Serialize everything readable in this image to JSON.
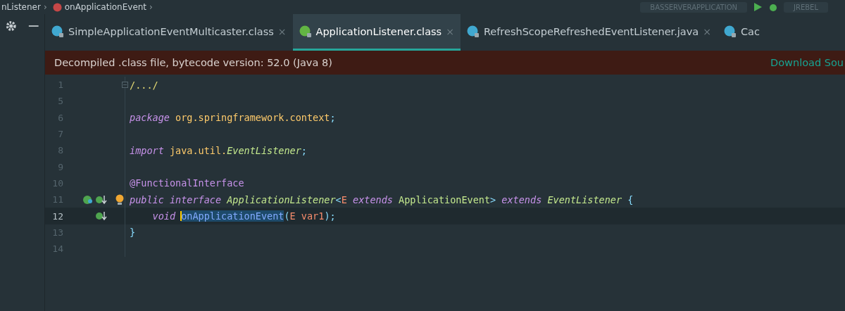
{
  "breadcrumbs": [
    {
      "label": "nListener",
      "kind": "interface",
      "separator": "›"
    },
    {
      "label": "onApplicationEvent",
      "kind": "method",
      "separator": "›"
    }
  ],
  "run_config": {
    "label": "BASSERVERAPPLICATION"
  },
  "plugin_config": {
    "label": "JREBEL"
  },
  "tabs": [
    {
      "label": "SimpleApplicationEventMulticaster.class",
      "kind": "class",
      "selected": false,
      "close": "×"
    },
    {
      "label": "ApplicationListener.class",
      "kind": "interface",
      "selected": true,
      "close": "×"
    },
    {
      "label": "RefreshScopeRefreshedEventListener.java",
      "kind": "class",
      "selected": false,
      "close": "×"
    },
    {
      "label": "Cac",
      "kind": "class",
      "selected": false
    }
  ],
  "banner": {
    "message": "Decompiled .class file, bytecode version: 52.0 (Java 8)",
    "action": "Download Sou"
  },
  "lines": [
    {
      "number": "1",
      "current": false,
      "folded": true,
      "tokens": [
        {
          "text": "/.../",
          "kind": "fold"
        }
      ]
    },
    {
      "number": "5",
      "current": false
    },
    {
      "number": "6",
      "current": false,
      "tokens": [
        {
          "text": "package",
          "kind": "keyword"
        },
        {
          "text": " org.springframework.context",
          "kind": "name"
        },
        {
          "text": ";",
          "kind": "punct"
        }
      ]
    },
    {
      "number": "7",
      "current": false
    },
    {
      "number": "8",
      "current": false,
      "tokens": [
        {
          "text": "import",
          "kind": "keyword"
        },
        {
          "text": " java.util.",
          "kind": "name"
        },
        {
          "text": "EventListener",
          "kind": "itype"
        },
        {
          "text": ";",
          "kind": "punct"
        }
      ]
    },
    {
      "number": "9",
      "current": false
    },
    {
      "number": "10",
      "current": false,
      "tokens": [
        {
          "text": "@FunctionalInterface",
          "kind": "annotation"
        }
      ]
    },
    {
      "number": "11",
      "current": false,
      "bulb": true,
      "implemented_marker": true,
      "override_marker": true,
      "tokens": [
        {
          "text": "public interface",
          "kind": "keyword"
        },
        {
          "text": " ApplicationListener",
          "kind": "itype"
        },
        {
          "text": "<",
          "kind": "punct"
        },
        {
          "text": "E",
          "kind": "param"
        },
        {
          "text": " extends",
          "kind": "keyword"
        },
        {
          "text": " ApplicationEvent",
          "kind": "class"
        },
        {
          "text": ">",
          "kind": "punct"
        },
        {
          "text": " extends",
          "kind": "keyword"
        },
        {
          "text": " EventListener",
          "kind": "itype"
        },
        {
          "text": " {",
          "kind": "punct"
        }
      ]
    },
    {
      "number": "12",
      "current": true,
      "override_marker": true,
      "tokens": [
        {
          "text": "    void ",
          "kind": "keyword"
        },
        {
          "text": "onApplicationEvent",
          "kind": "method",
          "selected": true,
          "caret": true
        },
        {
          "text": "(",
          "kind": "punct"
        },
        {
          "text": "E var1",
          "kind": "param"
        },
        {
          "text": ");",
          "kind": "punct"
        }
      ]
    },
    {
      "number": "13",
      "current": false,
      "tokens": [
        {
          "text": "}",
          "kind": "punct"
        }
      ]
    },
    {
      "number": "14",
      "current": false
    }
  ]
}
